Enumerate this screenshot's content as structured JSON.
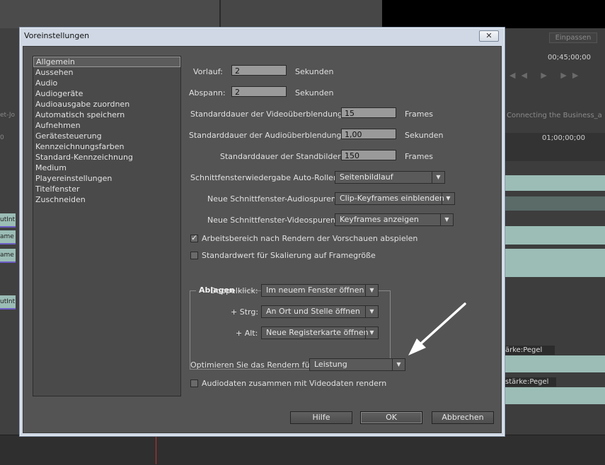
{
  "background": {
    "fit_label": "Einpassen",
    "timecode_1": "00;45;00;00",
    "timecode_2": "01;00;00;00",
    "sequence_title": "Connecting the Business_a",
    "left_clip_labels": [
      "utInt",
      "ame",
      "ame",
      "utInt"
    ],
    "left_strip_labels": [
      "et-Jo",
      "0"
    ],
    "volume_label": "ärke:Pegel",
    "volume_label_2": "stärke:Pegel"
  },
  "dialog": {
    "title": "Voreinstellungen",
    "close_glyph": "✕",
    "categories": [
      "Allgemein",
      "Aussehen",
      "Audio",
      "Audiogeräte",
      "Audioausgabe zuordnen",
      "Automatisch speichern",
      "Aufnehmen",
      "Gerätesteuerung",
      "Kennzeichnungsfarben",
      "Standard-Kennzeichnung",
      "Medium",
      "Playereinstellungen",
      "Titelfenster",
      "Zuschneiden"
    ],
    "selected_category": "Allgemein",
    "vorlauf": {
      "label": "Vorlauf:",
      "value": "2",
      "unit": "Sekunden"
    },
    "abspann": {
      "label": "Abspann:",
      "value": "2",
      "unit": "Sekunden"
    },
    "video_transition": {
      "label": "Standarddauer der Videoüberblendung:",
      "value": "15",
      "unit": "Frames"
    },
    "audio_transition": {
      "label": "Standarddauer der Audioüberblendung:",
      "value": "1,00",
      "unit": "Sekunden"
    },
    "still_duration": {
      "label": "Standarddauer der Standbilder:",
      "value": "150",
      "unit": "Frames"
    },
    "autoscroll": {
      "label": "Schnittfensterwiedergabe Auto-Rollen:",
      "value": "Seitenbildlauf"
    },
    "audio_tracks": {
      "label": "Neue Schnittfenster-Audiospuren:",
      "value": "Clip-Keyframes einblenden"
    },
    "video_tracks": {
      "label": "Neue Schnittfenster-Videospuren:",
      "value": "Keyframes anzeigen"
    },
    "cb_workarea": {
      "label": "Arbeitsbereich nach Rendern der Vorschauen abspielen",
      "checked": true
    },
    "cb_scale": {
      "label": "Standardwert für Skalierung auf Framegröße",
      "checked": false
    },
    "ablagen": {
      "title": "Ablagen",
      "doppelklick": {
        "label": "Doppelklick:",
        "value": "Im neuem Fenster öffnen"
      },
      "strg": {
        "label": "+ Strg:",
        "value": "An Ort und Stelle öffnen"
      },
      "alt": {
        "label": "+ Alt:",
        "value": "Neue Registerkarte öffnen"
      }
    },
    "optimize": {
      "label": "Optimieren Sie das Rendern für:",
      "value": "Leistung"
    },
    "cb_audio": {
      "label": "Audiodaten zusammen mit Videodaten rendern",
      "checked": false
    },
    "buttons": {
      "help": "Hilfe",
      "ok": "OK",
      "cancel": "Abbrechen"
    },
    "check_glyph": "✓",
    "dropdown_glyph": "▼"
  }
}
